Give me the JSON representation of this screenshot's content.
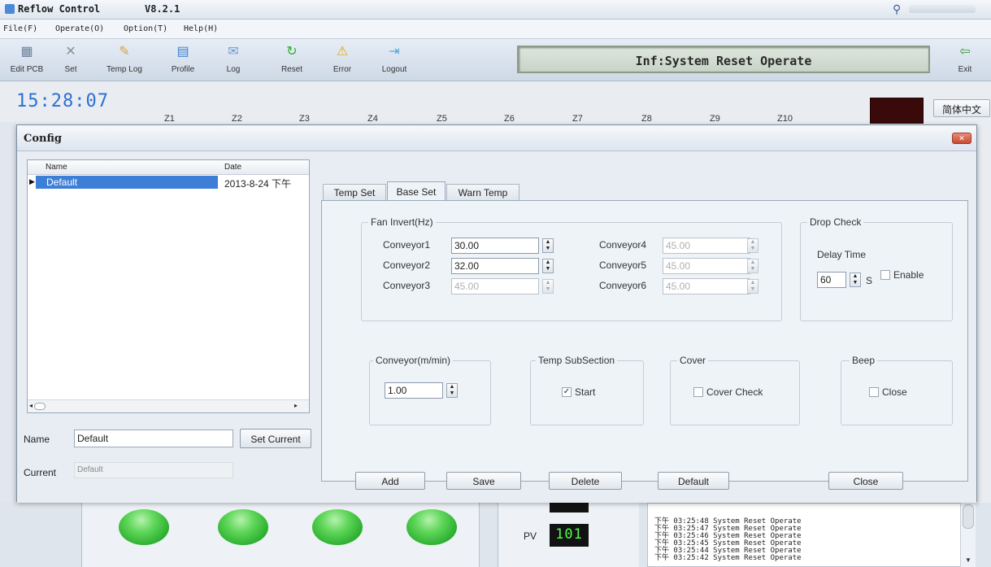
{
  "app": {
    "title": "Reflow Control",
    "version": "V8.2.1"
  },
  "menu": [
    "File(F)",
    "Operate(O)",
    "Option(T)",
    "Help(H)"
  ],
  "toolbar": [
    "Edit PCB",
    "Set",
    "Temp Log",
    "Profile",
    "Log",
    "Reset",
    "Error",
    "Logout",
    "Exit"
  ],
  "status": "Inf:System Reset Operate",
  "clock": "15:28:07",
  "zones": [
    "Z1",
    "Z2",
    "Z3",
    "Z4",
    "Z5",
    "Z6",
    "Z7",
    "Z8",
    "Z9",
    "Z10"
  ],
  "language_button": "简体中文",
  "dialog": {
    "title": "Config",
    "list": {
      "headers": [
        "Name",
        "Date"
      ],
      "rows": [
        {
          "name": "Default",
          "date": "2013-8-24 下午"
        }
      ]
    },
    "name_label": "Name",
    "name_value": "Default",
    "set_current_button": "Set Current",
    "current_label": "Current",
    "current_value": "Default",
    "tabs": [
      "Temp Set",
      "Base Set",
      "Warn Temp"
    ],
    "fan_invert": {
      "title": "Fan Invert(Hz)",
      "conveyors": [
        {
          "label": "Conveyor1",
          "value": "30.00",
          "enabled": true
        },
        {
          "label": "Conveyor2",
          "value": "32.00",
          "enabled": true
        },
        {
          "label": "Conveyor3",
          "value": "45.00",
          "enabled": false
        },
        {
          "label": "Conveyor4",
          "value": "45.00",
          "enabled": false
        },
        {
          "label": "Conveyor5",
          "value": "45.00",
          "enabled": false
        },
        {
          "label": "Conveyor6",
          "value": "45.00",
          "enabled": false
        }
      ]
    },
    "drop_check": {
      "title": "Drop Check",
      "delay_label": "Delay Time",
      "delay_value": "60",
      "unit": "S",
      "enable_label": "Enable",
      "enable_checked": false
    },
    "conveyor_speed": {
      "title": "Conveyor(m/min)",
      "value": "1.00"
    },
    "temp_subsection": {
      "title": "Temp SubSection",
      "start_label": "Start",
      "checked": true
    },
    "cover": {
      "title": "Cover",
      "check_label": "Cover Check",
      "checked": false
    },
    "beep": {
      "title": "Beep",
      "close_label": "Close",
      "checked": false
    },
    "buttons": [
      "Add",
      "Save",
      "Delete",
      "Default",
      "Close"
    ]
  },
  "pv": {
    "label": "PV",
    "value": "101"
  },
  "log": [
    "下午 03:25:48 System Reset Operate",
    "下午 03:25:47 System Reset Operate",
    "下午 03:25:46 System Reset Operate",
    "下午 03:25:45 System Reset Operate",
    "下午 03:25:44 System Reset Operate",
    "下午 03:25:42 System Reset Operate"
  ]
}
